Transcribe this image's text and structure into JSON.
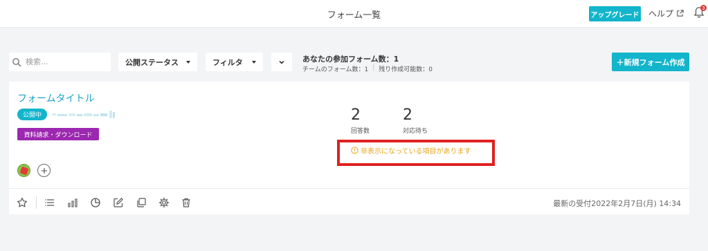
{
  "header": {
    "title": "フォーム一覧",
    "upgrade_label": "アップグレード",
    "help_label": "ヘルプ",
    "notification_count": "3"
  },
  "toolbar": {
    "search_placeholder": "検索...",
    "status_select": "公開ステータス",
    "filter_select": "フィルタ",
    "participating_forms": "あなたの参加フォーム数：1",
    "team_forms": "チームのフォーム数：1",
    "remaining_forms": "残り作成可能数：0",
    "new_form_label": "＋新規フォーム作成"
  },
  "form_card": {
    "title": "フォームタイトル",
    "status": "公開中",
    "tag": "資料請求・ダウンロード",
    "responses_count": "2",
    "responses_label": "回答数",
    "pending_count": "2",
    "pending_label": "対応待ち",
    "hidden_items_warning": "非表示になっている項目があります",
    "last_received": "最新の受付2022年2月7日(月) 14:34"
  },
  "colors": {
    "accent": "#12b5cb",
    "tag": "#9c27b0",
    "warning": "#e6a51a",
    "highlight": "#e0201f"
  }
}
